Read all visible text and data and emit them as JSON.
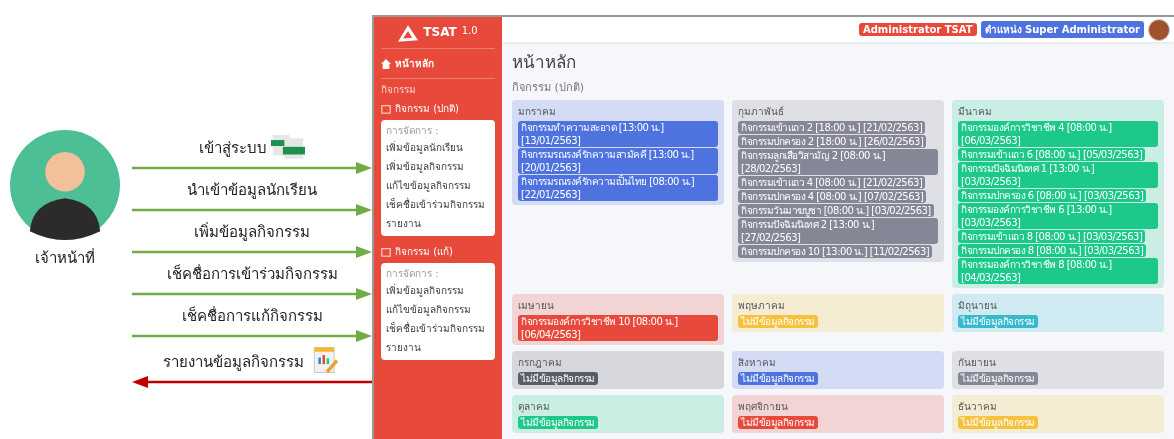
{
  "actor": {
    "label": "เจ้าหน้าที่"
  },
  "flows": [
    {
      "label": "เข้าสู่ระบบ",
      "kind": "import"
    },
    {
      "label": "นำเข้าข้อมูลนักเรียน",
      "kind": "send"
    },
    {
      "label": "เพิ่มข้อมูลกิจกรรม",
      "kind": "send"
    },
    {
      "label": "เช็คชื่อการเข้าร่วมกิจกรรม",
      "kind": "send"
    },
    {
      "label": "เช็คชื่อการแก้กิจกรรม",
      "kind": "send"
    },
    {
      "label": "รายงานข้อมูลกิจกรรม",
      "kind": "report"
    }
  ],
  "app": {
    "logo": {
      "name": "TSAT",
      "version": "1.0"
    },
    "sidebar": {
      "home": "หน้าหลัก",
      "section_label": "กิจกรรม",
      "groups": [
        {
          "title": "กิจกรรม (ปกติ)",
          "menu_label": "การจัดการ :",
          "items": [
            "เพิ่มข้อมูลนักเรียน",
            "เพิ่มข้อมูลกิจกรรม",
            "แก้ไขข้อมูลกิจกรรม",
            "เช็คชื่อเข้าร่วมกิจกรรม",
            "รายงาน"
          ]
        },
        {
          "title": "กิจกรรม (แก้)",
          "menu_label": "การจัดการ :",
          "items": [
            "เพิ่มข้อมูลกิจกรรม",
            "แก้ไขข้อมูลกิจกรรม",
            "เช็คชื่อเข้าร่วมกิจกรรม",
            "รายงาน"
          ]
        }
      ]
    },
    "header": {
      "badges": [
        {
          "text": "Administrator TSAT",
          "color": "#e74a3b"
        },
        {
          "text": "ตำแหน่ง Super Administrator",
          "color": "#4e73df"
        }
      ]
    },
    "page_title": "หน้าหลัก",
    "section_title": "กิจกรรม (ปกติ)",
    "months": [
      {
        "name": "มกราคม",
        "color": "#4e73df",
        "events": [
          "กิจกรรมทำความสะอาด [13:00 น.] [13/01/2563]",
          "กิจกรรมรณรงค์รักความสามัคคี [13:00 น.] [20/01/2563]",
          "กิจกรรมรณรงค์รักความเป็นไทย [08:00 น.] [22/01/2563]"
        ]
      },
      {
        "name": "กุมภาพันธ์",
        "color": "#858796",
        "events": [
          "กิจกรรมเข้าแถว 2 [18:00 น.] [21/02/2563]",
          "กิจกรรมปกครอง 2 [18:00 น.] [26/02/2563]",
          "กิจกรรมลูกเสือวิสามัญ 2 [08:00 น.] [28/02/2563]",
          "กิจกรรมเข้าแถว 4 [08:00 น.] [21/02/2563]",
          "กิจกรรมปกครอง 4 [08:00 น.] [07/02/2563]",
          "กิจกรรมวันมาฆบูชา [08:00 น.] [03/02/2563]",
          "กิจกรรมปัจฉิมนิเทศ 2 [13:00 น.] [27/02/2563]",
          "กิจกรรมปกครอง 10 [13:00 น.] [11/02/2563]"
        ]
      },
      {
        "name": "มีนาคม",
        "color": "#1cc88a",
        "events": [
          "กิจกรรมองค์การวิชาชีพ 4 [08:00 น.] [06/03/2563]",
          "กิจกรรมเข้าแถว 6 [08:00 น.] [05/03/2563]",
          "กิจกรรมปัจฉิมนิเทศ 1 [13:00 น.] [03/03/2563]",
          "กิจกรรมปกครอง 6 [08:00 น.] [03/03/2563]",
          "กิจกรรมองค์การวิชาชีพ 6 [13:00 น.] [03/03/2563]",
          "กิจกรรมเข้าแถว 8 [08:00 น.] [03/03/2563]",
          "กิจกรรมปกครอง 8 [08:00 น.] [03/03/2563]",
          "กิจกรรมองค์การวิชาชีพ 8 [08:00 น.] [04/03/2563]"
        ]
      },
      {
        "name": "เมษายน",
        "color": "#e74a3b",
        "events": [
          "กิจกรรมองค์การวิชาชีพ 10 [08:00 น.] [06/04/2563]"
        ]
      },
      {
        "name": "พฤษภาคม",
        "color": "#f6c23e",
        "events": [
          "ไม่มีข้อมูลกิจกรรม"
        ]
      },
      {
        "name": "มิถุนายน",
        "color": "#36b9cc",
        "events": [
          "ไม่มีข้อมูลกิจกรรม"
        ]
      },
      {
        "name": "กรกฎาคม",
        "color": "#5a5c69",
        "events": [
          "ไม่มีข้อมูลกิจกรรม"
        ]
      },
      {
        "name": "สิงหาคม",
        "color": "#4e73df",
        "events": [
          "ไม่มีข้อมูลกิจกรรม"
        ]
      },
      {
        "name": "กันยายน",
        "color": "#858796",
        "events": [
          "ไม่มีข้อมูลกิจกรรม"
        ]
      },
      {
        "name": "ตุลาคม",
        "color": "#1cc88a",
        "events": [
          "ไม่มีข้อมูลกิจกรรม"
        ]
      },
      {
        "name": "พฤศจิกายน",
        "color": "#e74a3b",
        "events": [
          "ไม่มีข้อมูลกิจกรรม"
        ]
      },
      {
        "name": "ธันวาคม",
        "color": "#f6c23e",
        "events": [
          "ไม่มีข้อมูลกิจกรรม"
        ]
      }
    ]
  }
}
